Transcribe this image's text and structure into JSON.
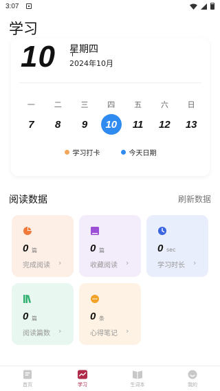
{
  "status_bar": {
    "time": "3:07"
  },
  "page": {
    "title": "学习"
  },
  "calendar": {
    "day": "10",
    "weekday": "星期四",
    "month": "2024年10月",
    "week_headers": [
      "一",
      "二",
      "三",
      "四",
      "五",
      "六",
      "日"
    ],
    "dates": [
      "7",
      "8",
      "9",
      "10",
      "11",
      "12",
      "13"
    ],
    "today_index": 3,
    "legend": [
      {
        "label": "学习打卡",
        "color": "#f2a65a"
      },
      {
        "label": "今天日期",
        "color": "#2f8bef"
      }
    ]
  },
  "reading": {
    "section_title": "阅读数据",
    "refresh_label": "刷新数据",
    "cards": [
      {
        "value": "0",
        "unit": "篇",
        "label": "完成阅读",
        "icon": "pie-chart-icon",
        "bg": "#fdeee6",
        "icon_color": "#f07a3a"
      },
      {
        "value": "0",
        "unit": "篇",
        "label": "收藏阅读",
        "icon": "bookmark-icon",
        "bg": "#f3ecfb",
        "icon_color": "#9b4fd6"
      },
      {
        "value": "0",
        "unit": "sec",
        "label": "学习时长",
        "icon": "clock-icon",
        "bg": "#e9eefc",
        "icon_color": "#3b64e0"
      },
      {
        "value": "0",
        "unit": "篇",
        "label": "阅读篇数",
        "icon": "books-icon",
        "bg": "#e8f7ef",
        "icon_color": "#2fb070"
      },
      {
        "value": "0",
        "unit": "条",
        "label": "心得笔记",
        "icon": "chat-icon",
        "bg": "#fdf2e3",
        "icon_color": "#f2a227"
      }
    ]
  },
  "tabbar": {
    "tabs": [
      {
        "label": "首页",
        "icon": "home-icon"
      },
      {
        "label": "学习",
        "icon": "study-icon"
      },
      {
        "label": "生词本",
        "icon": "vocab-book-icon"
      },
      {
        "label": "我的",
        "icon": "profile-icon"
      }
    ],
    "active_index": 1,
    "active_color": "#b02a4a"
  }
}
